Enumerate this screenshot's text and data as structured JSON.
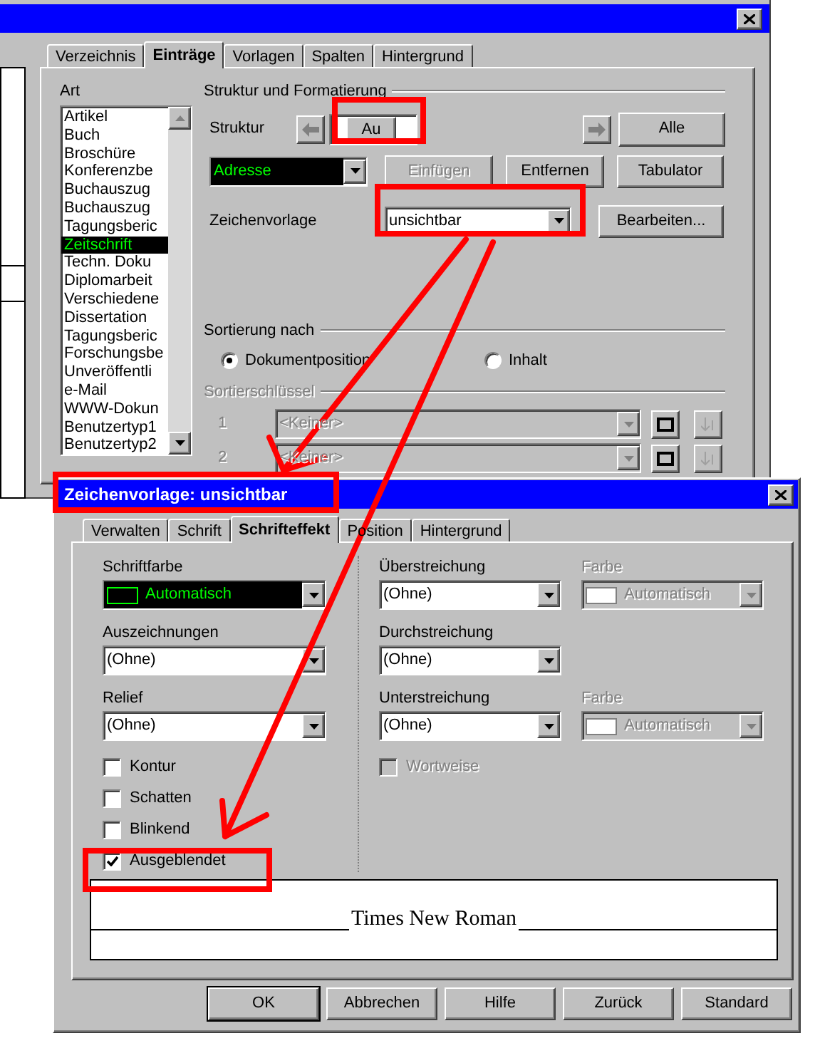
{
  "back_dialog": {
    "tabs": [
      {
        "label": "Verzeichnis",
        "selected": false
      },
      {
        "label": "Einträge",
        "selected": true
      },
      {
        "label": "Vorlagen",
        "selected": false
      },
      {
        "label": "Spalten",
        "selected": false
      },
      {
        "label": "Hintergrund",
        "selected": false
      }
    ],
    "art": {
      "label": "Art",
      "items": [
        {
          "label": "Artikel",
          "selected": false
        },
        {
          "label": "Buch",
          "selected": false
        },
        {
          "label": "Broschüre",
          "selected": false
        },
        {
          "label": "Konferenzbe",
          "selected": false
        },
        {
          "label": "Buchauszug",
          "selected": false
        },
        {
          "label": "Buchauszug",
          "selected": false
        },
        {
          "label": "Tagungsberic",
          "selected": false
        },
        {
          "label": "Zeitschrift",
          "selected": true
        },
        {
          "label": "Techn. Doku",
          "selected": false
        },
        {
          "label": "Diplomarbeit",
          "selected": false
        },
        {
          "label": "Verschiedene",
          "selected": false
        },
        {
          "label": "Dissertation",
          "selected": false
        },
        {
          "label": "Tagungsberic",
          "selected": false
        },
        {
          "label": "Forschungsbe",
          "selected": false
        },
        {
          "label": "Unveröffentli",
          "selected": false
        },
        {
          "label": "e-Mail",
          "selected": false
        },
        {
          "label": "WWW-Dokun",
          "selected": false
        },
        {
          "label": "Benutzertyp1",
          "selected": false
        },
        {
          "label": "Benutzertyp2",
          "selected": false
        }
      ]
    },
    "structure": {
      "heading": "Struktur und Formatierung",
      "label": "Struktur",
      "entry": "Au",
      "all_button": "Alle",
      "field_select": {
        "value": "Adresse",
        "highlighted": true
      },
      "buttons": [
        {
          "label": "Einfügen",
          "disabled": true
        },
        {
          "label": "Entfernen",
          "disabled": false
        },
        {
          "label": "Tabulator",
          "disabled": false
        }
      ],
      "style_label": "Zeichenvorlage",
      "style_select": {
        "value": "unsichtbar",
        "highlighted": false
      },
      "edit_button": "Bearbeiten..."
    },
    "sorting": {
      "heading": "Sortierung nach",
      "options": [
        {
          "label": "Dokumentposition",
          "selected": true
        },
        {
          "label": "Inhalt",
          "selected": false
        }
      ],
      "keys_heading": "Sortierschlüssel",
      "keys_disabled": true,
      "keys": [
        {
          "number": "1",
          "value": "<Keiner>"
        },
        {
          "number": "2",
          "value": "<Keiner>"
        }
      ]
    }
  },
  "front_dialog": {
    "title": "Zeichenvorlage: unsichtbar",
    "tabs": [
      {
        "label": "Verwalten",
        "selected": false
      },
      {
        "label": "Schrift",
        "selected": false
      },
      {
        "label": "Schrifteffekt",
        "selected": true
      },
      {
        "label": "Position",
        "selected": false
      },
      {
        "label": "Hintergrund",
        "selected": false
      }
    ],
    "left_selects": [
      {
        "label": "Schriftfarbe",
        "value": "Automatisch",
        "highlighted": true,
        "swatch": true
      },
      {
        "label": "Auszeichnungen",
        "value": "(Ohne)",
        "highlighted": false,
        "swatch": false
      },
      {
        "label": "Relief",
        "value": "(Ohne)",
        "highlighted": false,
        "swatch": false
      }
    ],
    "checkboxes": [
      {
        "label": "Kontur",
        "checked": false
      },
      {
        "label": "Schatten",
        "checked": false
      },
      {
        "label": "Blinkend",
        "checked": false
      },
      {
        "label": "Ausgeblendet",
        "checked": true
      }
    ],
    "right_rows": [
      {
        "label": "Überstreichung",
        "value": "(Ohne)",
        "color": {
          "label": "Farbe",
          "value": "Automatisch",
          "disabled": true
        }
      },
      {
        "label": "Durchstreichung",
        "value": "(Ohne)"
      },
      {
        "label": "Unterstreichung",
        "value": "(Ohne)",
        "color": {
          "label": "Farbe",
          "value": "Automatisch",
          "disabled": true
        }
      }
    ],
    "word_mode": {
      "label": "Wortweise",
      "checked": false,
      "disabled": true
    },
    "preview": "Times New Roman",
    "buttons": [
      {
        "label": "OK",
        "default": true
      },
      {
        "label": "Abbrechen",
        "default": false
      },
      {
        "label": "Hilfe",
        "default": false
      },
      {
        "label": "Zurück",
        "default": false
      },
      {
        "label": "Standard",
        "default": false
      }
    ]
  }
}
